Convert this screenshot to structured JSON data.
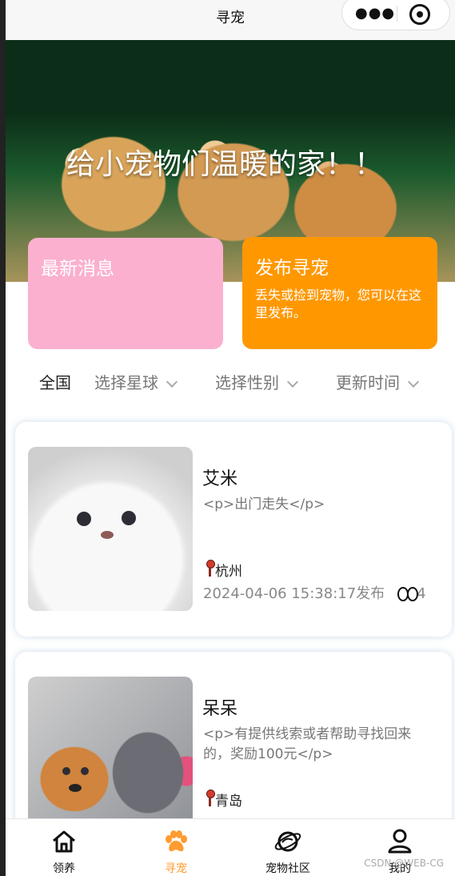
{
  "top_bar": {
    "title": "寻宠",
    "more_icon": "more-dots-icon",
    "close_icon": "target-close-icon"
  },
  "banner": {
    "title": "给小宠物们温暖的家！！"
  },
  "action_cards": {
    "latest": {
      "title": "最新消息",
      "color": "#fbb0cf"
    },
    "publish": {
      "title": "发布寻宠",
      "desc": "丢失或捡到宠物，您可以在这里发布。",
      "color": "#ff9800"
    }
  },
  "filters": {
    "all": "全国",
    "planet": "选择星球",
    "gender": "选择性别",
    "time": "更新时间"
  },
  "posts": [
    {
      "name": "艾米",
      "desc": "<p>出门走失</p>",
      "city": "杭州",
      "time": "2024-04-06 15:38:17发布",
      "views": "4"
    },
    {
      "name": "呆呆",
      "desc": "<p>有提供线索或者帮助寻找回来的，奖励100元</p>",
      "city": "青岛"
    }
  ],
  "tabbar": {
    "adopt": {
      "label": "领养",
      "icon": "home-icon"
    },
    "find": {
      "label": "寻宠",
      "icon": "paw-icon",
      "active_color": "#ff9b2f"
    },
    "community": {
      "label": "宠物社区",
      "icon": "planet-icon"
    },
    "mine": {
      "label": "我的",
      "icon": "user-icon"
    }
  },
  "watermark": "CSDN @WEB-CG"
}
